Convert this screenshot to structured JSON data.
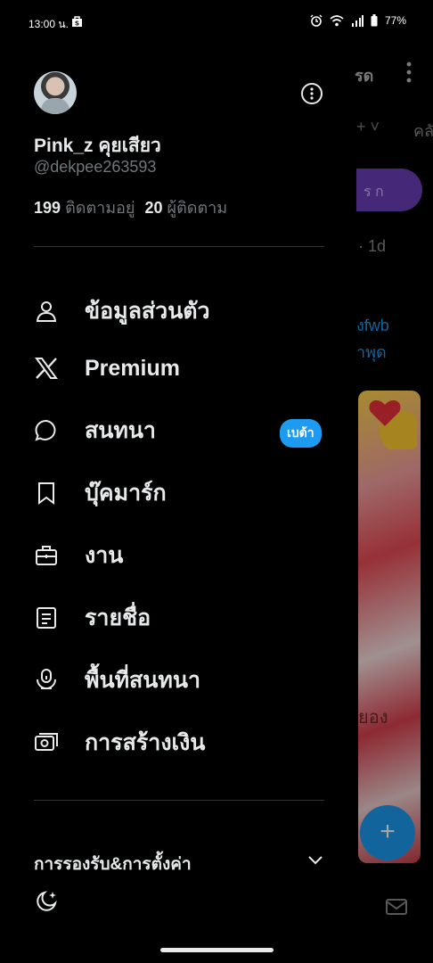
{
  "status_bar": {
    "time": "13:00 น.",
    "battery": "77%",
    "icons": [
      "store-icon",
      "alarm-icon",
      "wifi-icon",
      "signal-icon",
      "battery-icon"
    ]
  },
  "background": {
    "title_fragment": "รด",
    "tab_fragment": "คลั",
    "plus_fragment": "+ ˅",
    "pill_fragment": "ร ก",
    "time_fragment": "· 1d",
    "link_line1": "งfwb",
    "link_line2": "าพุด",
    "media_text": "ยอง",
    "fab_label": "+"
  },
  "profile": {
    "name": "Pink_z คุยเสียว",
    "handle": "@dekpee263593",
    "following_count": "199",
    "following_label": "ติดตามอยู่",
    "followers_count": "20",
    "followers_label": "ผู้ติดตาม"
  },
  "menu": {
    "items": [
      {
        "label": "ข้อมูลส่วนตัว",
        "icon": "person-icon"
      },
      {
        "label": "Premium",
        "icon": "x-logo-icon"
      },
      {
        "label": "สนทนา",
        "icon": "chat-bubble-icon",
        "badge": "เบต้า"
      },
      {
        "label": "บุ๊คมาร์ก",
        "icon": "bookmark-icon"
      },
      {
        "label": "งาน",
        "icon": "briefcase-icon"
      },
      {
        "label": "รายชื่อ",
        "icon": "list-icon"
      },
      {
        "label": "พื้นที่สนทนา",
        "icon": "spaces-icon"
      },
      {
        "label": "การสร้างเงิน",
        "icon": "money-icon"
      }
    ]
  },
  "settings": {
    "label": "การรองรับ&การตั้งค่า"
  },
  "colors": {
    "background": "#000000",
    "text": "#e7e9ea",
    "muted": "#71767b",
    "accent": "#1d9bf0",
    "divider": "#2f3336"
  }
}
